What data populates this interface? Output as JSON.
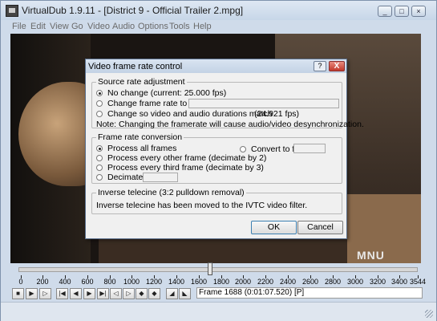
{
  "window": {
    "title": "VirtualDub 1.9.11 - [District 9 - Official Trailer 2.mpg]"
  },
  "menu": [
    "File",
    "Edit",
    "View",
    "Go",
    "Video",
    "Audio",
    "Options",
    "Tools",
    "Help"
  ],
  "video": {
    "watermark": "MNU"
  },
  "dialog": {
    "title": "Video frame rate control",
    "help_button": "?",
    "close_button": "X",
    "source": {
      "label": "Source rate adjustment",
      "no_change": "No change (current: 25.000 fps)",
      "change_rate": "Change frame rate to (fps):",
      "match": "Change so video and audio durations match",
      "match_value": "(24.921 fps)",
      "note": "Note: Changing the framerate will cause audio/video desynchronization."
    },
    "conversion": {
      "label": "Frame rate conversion",
      "all": "Process all frames",
      "convert_fps": "Convert to fps:",
      "other": "Process every other frame (decimate by 2)",
      "third": "Process every third frame (decimate by 3)",
      "decimate": "Decimate by"
    },
    "ivtc": {
      "label": "Inverse telecine (3:2 pulldown removal)",
      "text": "Inverse telecine has been moved to the IVTC video filter."
    },
    "ok": "OK",
    "cancel": "Cancel"
  },
  "timeline": {
    "ticks": [
      "0",
      "200",
      "400",
      "600",
      "800",
      "1000",
      "1200",
      "1400",
      "1600",
      "1800",
      "2000",
      "2200",
      "2400",
      "2600",
      "2800",
      "3000",
      "3200",
      "3400",
      "3544"
    ],
    "frame_text": "Frame 1688 (0:01:07.520) [P]"
  }
}
